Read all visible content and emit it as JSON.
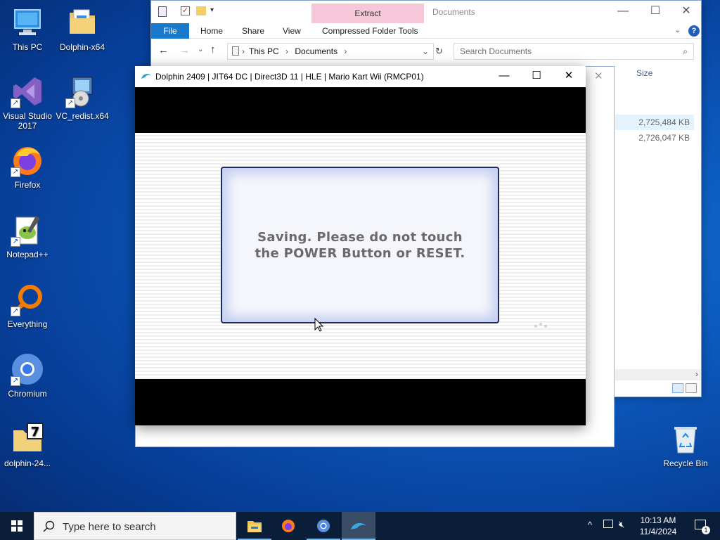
{
  "desktop": {
    "icons": [
      {
        "label": "This PC"
      },
      {
        "label": "Dolphin-x64"
      },
      {
        "label": "Visual Studio 2017"
      },
      {
        "label": "VC_redist.x64"
      },
      {
        "label": "Firefox"
      },
      {
        "label": "Notepad++"
      },
      {
        "label": "Everything"
      },
      {
        "label": "Chromium"
      },
      {
        "label": "dolphin-24..."
      },
      {
        "label": "Recycle Bin"
      }
    ]
  },
  "explorer": {
    "title": "Documents",
    "context_tab": "Extract",
    "ribbon_tabs": [
      "File",
      "Home",
      "Share",
      "View",
      "Compressed Folder Tools"
    ],
    "breadcrumb": [
      "This PC",
      "Documents"
    ],
    "search_placeholder": "Search Documents",
    "column_header": "Size",
    "file_sizes": [
      "2,725,484 KB",
      "2,726,047 KB"
    ]
  },
  "dolphin": {
    "title": "Dolphin 2409 | JIT64 DC | Direct3D 11 | HLE | Mario Kart Wii (RMCP01)",
    "dialog_line1": "Saving. Please do not touch",
    "dialog_line2": "the POWER Button or RESET."
  },
  "taskbar": {
    "search_placeholder": "Type here to search",
    "time": "10:13 AM",
    "date": "11/4/2024",
    "notification_count": "1"
  },
  "colors": {
    "accent": "#1979ca",
    "context_tab": "#f6c7d8",
    "taskbar": "#0b1e39"
  }
}
